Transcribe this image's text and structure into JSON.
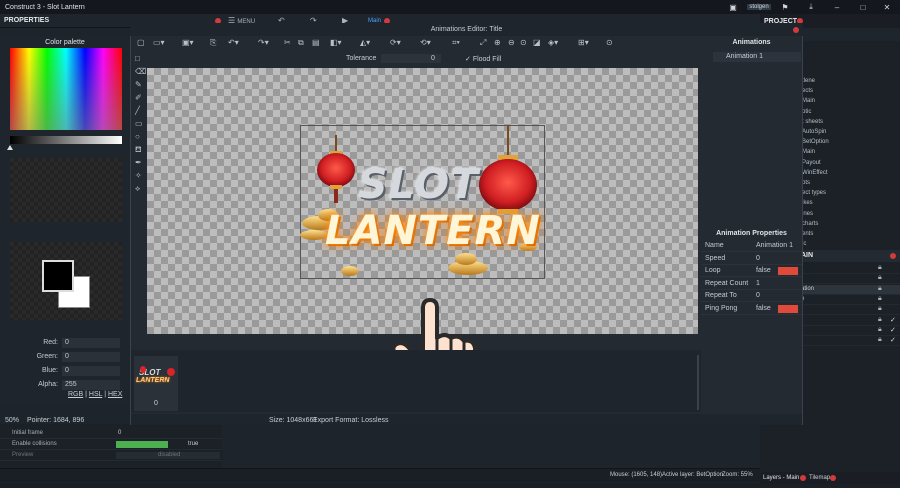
{
  "window": {
    "title": "Construct 3 - Slot Lantern"
  },
  "main_toolbar": {
    "menu_label": "MENU",
    "tab_label": "Main"
  },
  "header": {
    "user_badge": "stolgen"
  },
  "properties_panel": {
    "title": "PROPERTIES",
    "rows": [
      {
        "name": "Initial frame",
        "value": "0"
      },
      {
        "name": "Enable collisions",
        "value": "true"
      },
      {
        "name": "Preview",
        "value": "disabled"
      }
    ]
  },
  "project_panel": {
    "title": "PROJECT",
    "items": [
      "tlene",
      "ects",
      "Main",
      "otic",
      "t sheets",
      "AutoSpin",
      "BetOption",
      "Main",
      "Payout",
      "WinEffect",
      "pts",
      "ect types",
      "ikes",
      "ines",
      "charts",
      "ents",
      "ic",
      "s",
      "ts"
    ]
  },
  "layers_panel": {
    "title": "AIN",
    "rows": [
      "",
      "",
      "ation",
      "e",
      "",
      "",
      "",
      ""
    ]
  },
  "bottom_tabs": {
    "layers": "Layers - Main",
    "tilemap": "Tilemap"
  },
  "status_bar": {
    "mouse": "Mouse: (1605, 148)",
    "active_layer": "Active layer: BetOption",
    "zoom": "Zoom: 55%"
  },
  "editor": {
    "title": "Animations Editor: Title",
    "tolerance_label": "Tolerance",
    "tolerance_value": "0",
    "flood_fill_label": "Flood Fill",
    "zoom": "50%",
    "pointer": "Pointer: 1684, 896",
    "size": "Size: 1048x661",
    "export_format": "Export Format: Lossless",
    "frame_index": "0"
  },
  "sprite": {
    "line1": "SLOT",
    "line2": "LANTERN"
  },
  "color_palette": {
    "title": "Color palette",
    "fields": [
      {
        "label": "Red:",
        "value": "0"
      },
      {
        "label": "Green:",
        "value": "0"
      },
      {
        "label": "Blue:",
        "value": "0"
      },
      {
        "label": "Alpha:",
        "value": "255"
      }
    ],
    "modes": [
      "RGB",
      "HSL",
      "HEX"
    ]
  },
  "animations_panel": {
    "title": "Animations",
    "items": [
      "Animation 1"
    ]
  },
  "animation_properties": {
    "title": "Animation Properties",
    "rows": [
      {
        "name": "Name",
        "value": "Animation 1",
        "toggle": false
      },
      {
        "name": "Speed",
        "value": "0",
        "toggle": false
      },
      {
        "name": "Loop",
        "value": "false",
        "toggle": true
      },
      {
        "name": "Repeat Count",
        "value": "1",
        "toggle": false
      },
      {
        "name": "Repeat To",
        "value": "0",
        "toggle": false
      },
      {
        "name": "Ping Pong",
        "value": "false",
        "toggle": true
      }
    ]
  },
  "colors": {
    "accent_red": "#d23b3b",
    "toggle_red": "#e04a3a",
    "collision_green": "#4caf50",
    "lantern_red": "#d8242a",
    "title_orange": "#ffb43a"
  }
}
